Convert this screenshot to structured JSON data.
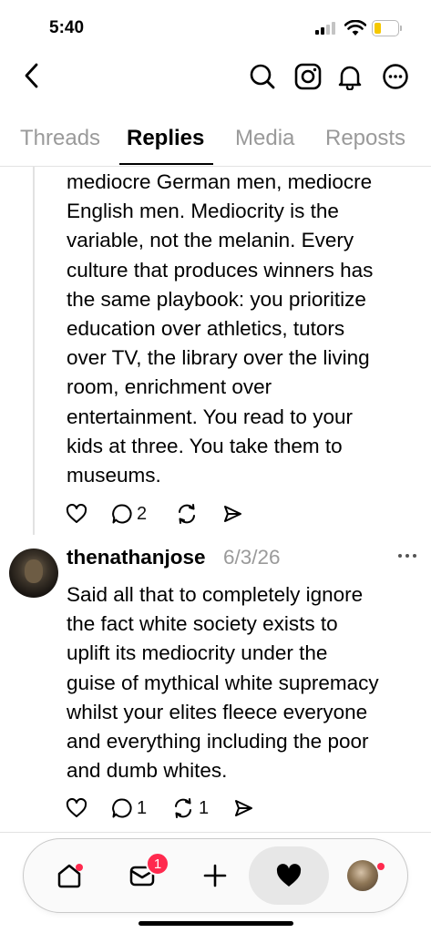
{
  "status_bar": {
    "time": "5:40"
  },
  "tabs": [
    {
      "label": "Threads",
      "active": false
    },
    {
      "label": "Replies",
      "active": true
    },
    {
      "label": "Media",
      "active": false
    },
    {
      "label": "Reposts",
      "active": false
    }
  ],
  "post1": {
    "lines": [
      "mediocre German men, mediocre",
      "English men. Mediocrity is the",
      "variable, not the melanin. Every",
      "culture that produces winners has",
      "the same playbook: you prioritize",
      "education over athletics, tutors",
      "over TV, the library over the living",
      "room, enrichment over",
      "entertainment. You read to your",
      "kids at three. You take them to",
      "museums."
    ],
    "reply_count": "2"
  },
  "post2": {
    "username": "thenathanjose",
    "date": "6/3/26",
    "lines": [
      "Said all that to completely ignore",
      "the fact white society exists to",
      "uplift its mediocrity under the",
      "guise of mythical white supremacy",
      "whilst your elites fleece everyone",
      "and everything including the poor",
      "and dumb whites."
    ],
    "reply_count": "1",
    "repost_count": "1"
  },
  "bottom_nav": {
    "inbox_badge": "1"
  },
  "colors": {
    "accent_red": "#ff2a4e",
    "battery_yellow": "#f5c800",
    "muted": "#9a9a9a"
  }
}
